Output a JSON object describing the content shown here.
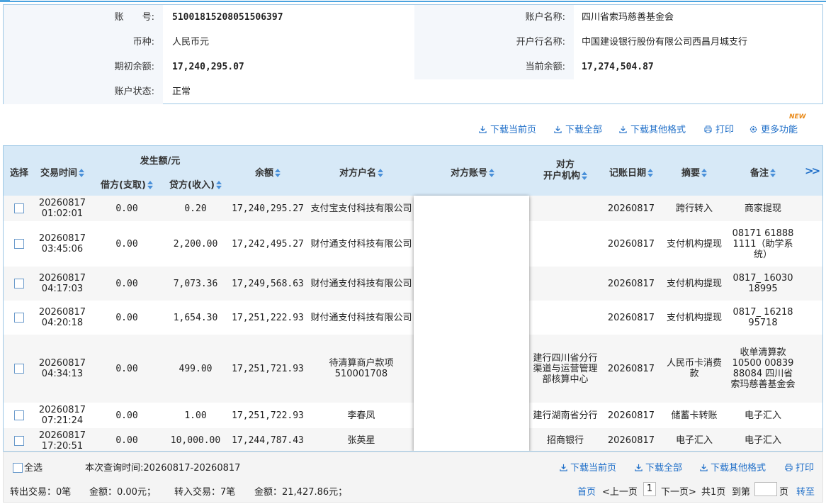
{
  "account": {
    "account_no_label": "账　　号:",
    "account_no": "51001815208051506397",
    "account_name_label": "账户名称:",
    "account_name": "四川省索玛慈善基金会",
    "currency_label": "币种:",
    "currency": "人民币元",
    "bank_label": "开户行名称:",
    "bank": "中国建设银行股份有限公司西昌月城支行",
    "opening_balance_label": "期初余额:",
    "opening_balance": "17,240,295.07",
    "current_balance_label": "当前余额:",
    "current_balance": "17,274,504.87",
    "status_label": "账户状态:",
    "status": "正常"
  },
  "toolbar": {
    "download_page": "下载当前页",
    "download_all": "下载全部",
    "download_other": "下载其他格式",
    "print": "打印",
    "more": "更多功能",
    "new_badge": "NEW"
  },
  "table": {
    "headers": {
      "select": "选择",
      "time": "交易时间",
      "amount_group": "发生额/元",
      "debit": "借方(支取)",
      "credit": "贷方(收入)",
      "balance": "余额",
      "party_name": "对方户名",
      "party_account": "对方账号",
      "party_bank_line1": "对方",
      "party_bank_line2": "开户机构",
      "book_date": "记账日期",
      "summary": "摘要",
      "remark": "备注",
      "more_columns": ">>"
    },
    "rows": [
      {
        "date": "20260817",
        "time": "01:02:01",
        "debit": "0.00",
        "credit": "0.20",
        "balance": "17,240,295.27",
        "party_name": "支付宝支付科技有限公司",
        "party_bank": "",
        "book_date": "20260817",
        "summary": "跨行转入",
        "remark": "商家提现"
      },
      {
        "date": "20260817",
        "time": "03:45:06",
        "debit": "0.00",
        "credit": "2,200.00",
        "balance": "17,242,495.27",
        "party_name": "财付通支付科技有限公司",
        "party_bank": "",
        "book_date": "20260817",
        "summary": "支付机构提现",
        "remark": "08171 61888 1111（助学系统）"
      },
      {
        "date": "20260817",
        "time": "04:17:03",
        "debit": "0.00",
        "credit": "7,073.36",
        "balance": "17,249,568.63",
        "party_name": "财付通支付科技有限公司",
        "party_bank": "",
        "book_date": "20260817",
        "summary": "支付机构提现",
        "remark": "0817_ 16030 18995"
      },
      {
        "date": "20260817",
        "time": "04:20:18",
        "debit": "0.00",
        "credit": "1,654.30",
        "balance": "17,251,222.93",
        "party_name": "财付通支付科技有限公司",
        "party_bank": "",
        "book_date": "20260817",
        "summary": "支付机构提现",
        "remark": "0817_ 16218 95718"
      },
      {
        "date": "20260817",
        "time": "04:34:13",
        "debit": "0.00",
        "credit": "499.00",
        "balance": "17,251,721.93",
        "party_name": "待清算商户款项510001708",
        "party_bank": "建行四川省分行渠道与运营管理部核算中心",
        "book_date": "20260817",
        "summary": "人民币卡消费款",
        "remark": "收单清算款 10500 00839 88084 四川省索玛慈善基金会"
      },
      {
        "date": "20260817",
        "time": "07:21:24",
        "debit": "0.00",
        "credit": "1.00",
        "balance": "17,251,722.93",
        "party_name": "李春凤",
        "party_bank": "建行湖南省分行",
        "book_date": "20260817",
        "summary": "储蓄卡转账",
        "remark": "电子汇入"
      },
      {
        "date": "20260817",
        "time": "17:20:51",
        "debit": "0.00",
        "credit": "10,000.00",
        "balance": "17,244,787.43",
        "party_name": "张英星",
        "party_bank": "招商银行",
        "book_date": "20260817",
        "summary": "电子汇入",
        "remark": "电子汇入"
      }
    ]
  },
  "footer": {
    "select_all": "全选",
    "query_time": "本次查询时间:20260817-20260817",
    "download_page": "下载当前页",
    "download_all": "下载全部",
    "download_other": "下载其他格式",
    "print": "打印",
    "out_txn": "转出交易：0笔",
    "out_amount": "金额：0.00元；",
    "in_txn": "转入交易：7笔",
    "in_amount": "金额：21,427.86元；",
    "first_page": "首页",
    "prev_page": "<上一页",
    "current_page": "1",
    "next_page": "下一页>",
    "total_pages": "共1页",
    "goto_label": "到第",
    "goto_unit": "页",
    "goto_button": "转至"
  },
  "colors": {
    "accent_blue": "#1e6ec8",
    "header_bg": "#d7e9f7",
    "border": "#9ec8e6",
    "badge_orange": "#e98a1a"
  }
}
